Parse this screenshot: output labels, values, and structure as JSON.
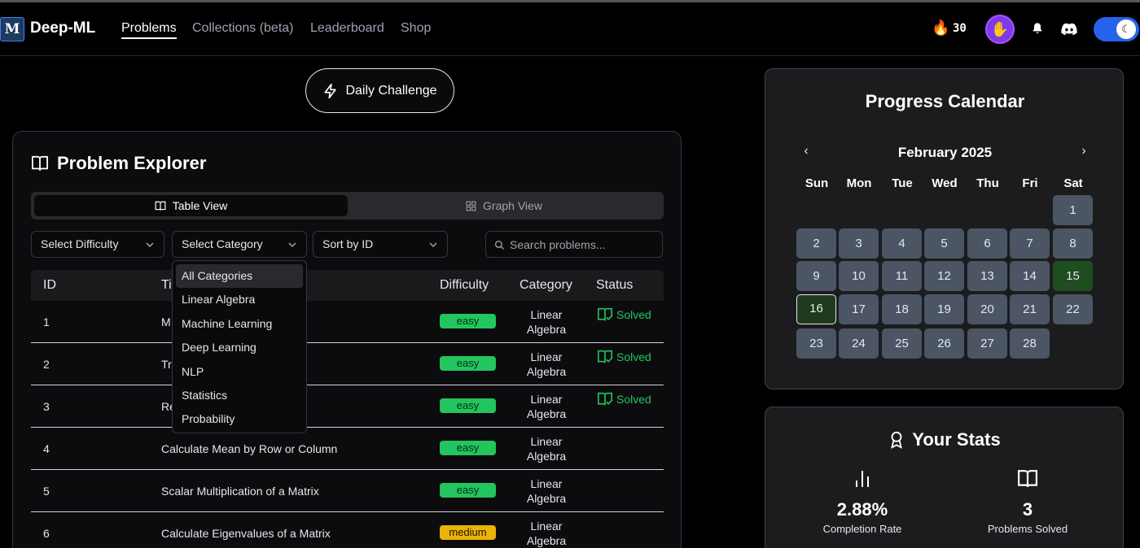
{
  "nav": {
    "logo": "M",
    "brand": "Deep-ML",
    "links": [
      "Problems",
      "Collections (beta)",
      "Leaderboard",
      "Shop"
    ],
    "streak": "30",
    "streak_icon": "fire-icon"
  },
  "daily_challenge": "Daily Challenge",
  "explorer": {
    "title": "Problem Explorer",
    "table_view": "Table View",
    "graph_view": "Graph View",
    "difficulty_select": "Select Difficulty",
    "category_select": "Select Category",
    "sort_select": "Sort by ID",
    "search_placeholder": "Search problems...",
    "columns": [
      "ID",
      "Ti",
      "Difficulty",
      "Category",
      "Status"
    ],
    "rows": [
      {
        "id": "1",
        "title": "M",
        "difficulty": "easy",
        "cat1": "Linear",
        "cat2": "Algebra",
        "status": "Solved"
      },
      {
        "id": "2",
        "title": "Tr",
        "difficulty": "easy",
        "cat1": "Linear",
        "cat2": "Algebra",
        "status": "Solved"
      },
      {
        "id": "3",
        "title": "Re",
        "difficulty": "easy",
        "cat1": "Linear",
        "cat2": "Algebra",
        "status": "Solved"
      },
      {
        "id": "4",
        "title": "Calculate Mean by Row or Column",
        "difficulty": "easy",
        "cat1": "Linear",
        "cat2": "Algebra",
        "status": ""
      },
      {
        "id": "5",
        "title": "Scalar Multiplication of a Matrix",
        "difficulty": "easy",
        "cat1": "Linear",
        "cat2": "Algebra",
        "status": ""
      },
      {
        "id": "6",
        "title": "Calculate Eigenvalues of a Matrix",
        "difficulty": "medium",
        "cat1": "Linear",
        "cat2": "Algebra",
        "status": ""
      }
    ],
    "category_options": [
      "All Categories",
      "Linear Algebra",
      "Machine Learning",
      "Deep Learning",
      "NLP",
      "Statistics",
      "Probability"
    ]
  },
  "calendar": {
    "title": "Progress Calendar",
    "month": "February 2025",
    "prev": "‹",
    "next": "›",
    "weekdays": [
      "Sun",
      "Mon",
      "Tue",
      "Wed",
      "Thu",
      "Fri",
      "Sat"
    ],
    "first_weekday": 6,
    "days_in_month": 28,
    "solved_days": [
      15
    ],
    "today": 16
  },
  "stats": {
    "title": "Your Stats",
    "completion_rate": "2.88%",
    "completion_label": "Completion Rate",
    "problems_solved": "3",
    "solved_label": "Problems Solved"
  },
  "colors": {
    "accent": "#2563eb",
    "easy": "#22c55e",
    "medium": "#eab308",
    "solved_day": "#1e4d20"
  }
}
